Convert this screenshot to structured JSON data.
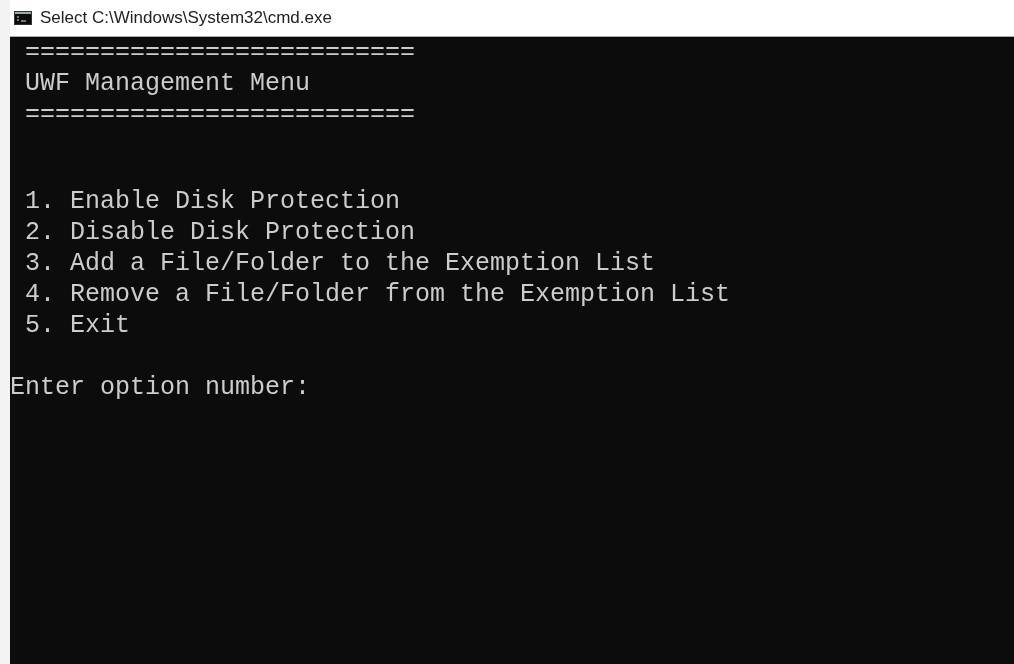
{
  "window": {
    "title": "Select C:\\Windows\\System32\\cmd.exe"
  },
  "console": {
    "banner": [
      "==========================",
      "UWF Management Menu",
      "=========================="
    ],
    "menu": [
      "1. Enable Disk Protection",
      "2. Disable Disk Protection",
      "3. Add a File/Folder to the Exemption List",
      "4. Remove a File/Folder from the Exemption List",
      "5. Exit"
    ],
    "prompt": "Enter option number:"
  }
}
